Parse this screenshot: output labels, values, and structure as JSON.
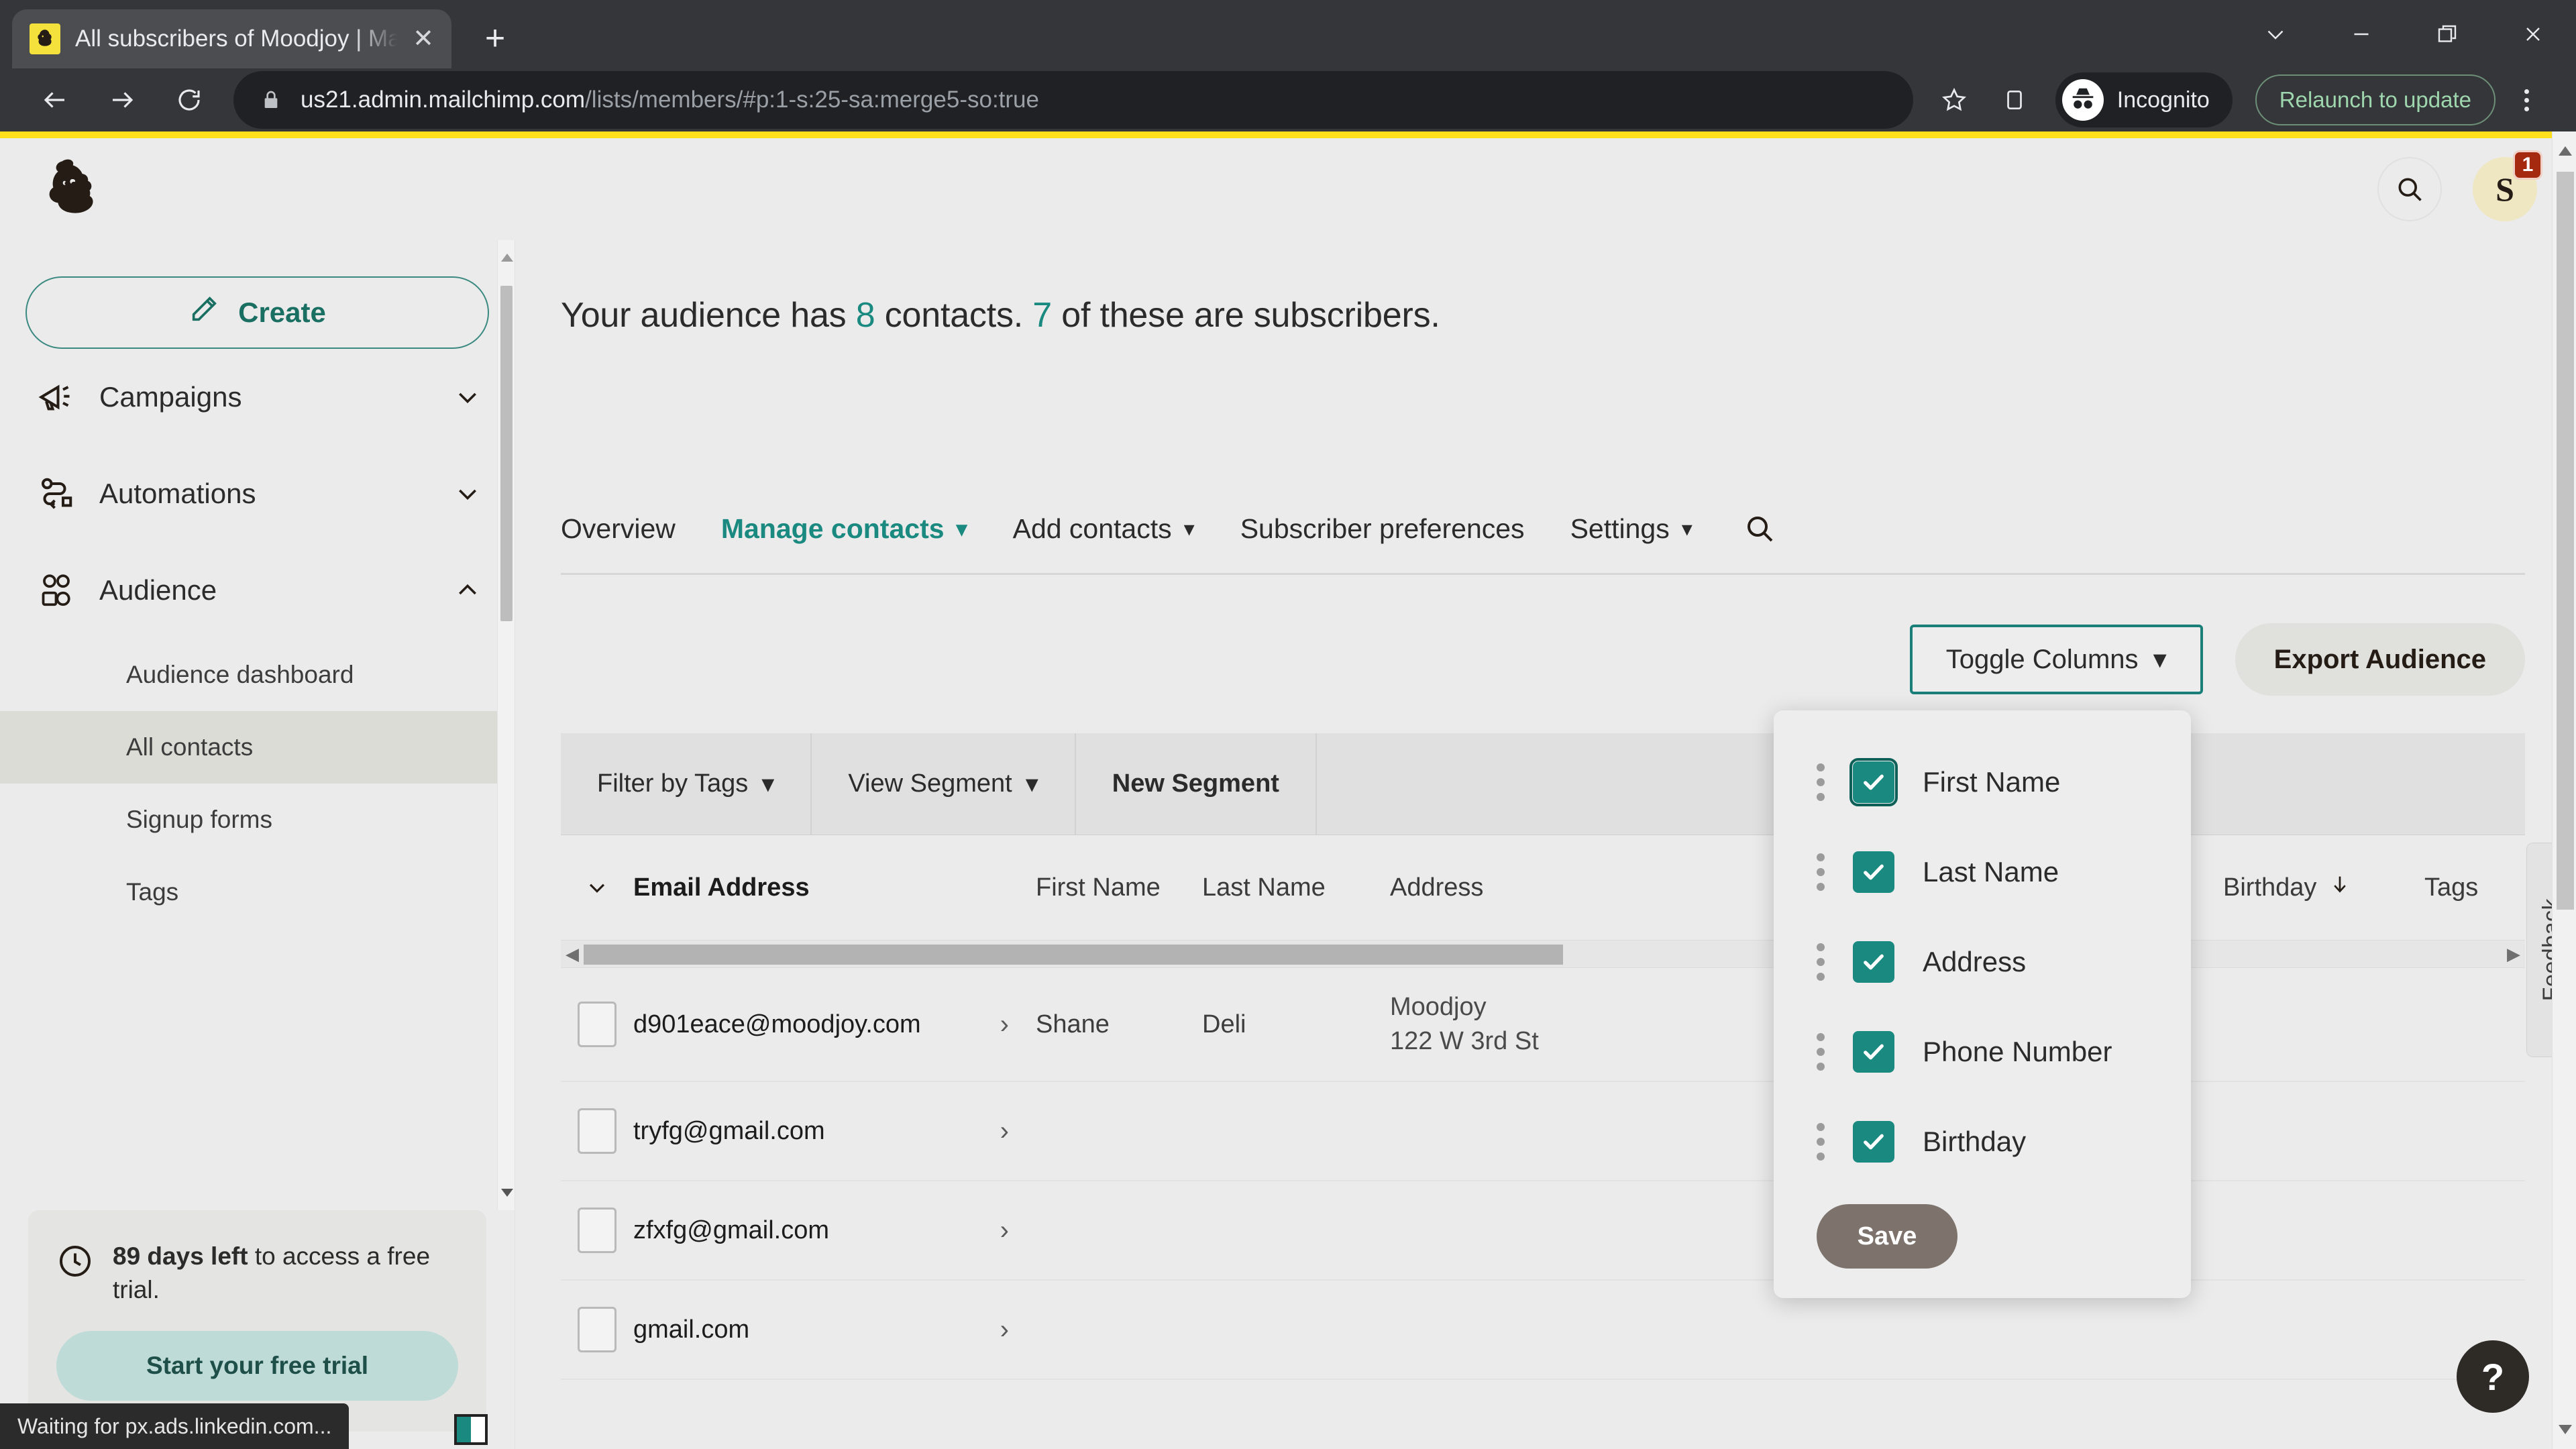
{
  "browser": {
    "tab": {
      "title": "All subscribers of Moodjoy | Mai",
      "favicon_icon": "mailchimp-favicon",
      "close_icon": "close-icon"
    },
    "new_tab_icon": "plus-icon",
    "window_controls": [
      {
        "name": "tab-search",
        "icon": "chevron-down-icon"
      },
      {
        "name": "minimize",
        "icon": "minimize-icon"
      },
      {
        "name": "maximize",
        "icon": "restore-icon"
      },
      {
        "name": "close",
        "icon": "close-icon"
      }
    ],
    "nav": {
      "back_icon": "arrow-left-icon",
      "forward_icon": "arrow-right-icon",
      "reload_icon": "reload-icon"
    },
    "omnibox": {
      "lock_icon": "lock-icon",
      "url_domain": "us21.admin.mailchimp.com",
      "url_path": "/lists/members/#p:1-s:25-sa:merge5-so:true"
    },
    "bookmark_icon": "star-icon",
    "side_panel_icon": "side-panel-icon",
    "incognito_label": "Incognito",
    "incognito_icon": "incognito-icon",
    "relaunch_label": "Relaunch to update",
    "menu_icon": "kebab-menu-icon",
    "status_text": "Waiting for px.ads.linkedin.com..."
  },
  "app": {
    "logo_icon": "mailchimp-logo",
    "search_icon": "search-icon",
    "avatar_initial": "S",
    "notification_count": "1"
  },
  "sidebar": {
    "create_label": "Create",
    "create_icon": "pencil-icon",
    "nav": [
      {
        "label": "Campaigns",
        "icon": "megaphone-icon",
        "chevron": "chevron-down-icon",
        "expanded": false
      },
      {
        "label": "Automations",
        "icon": "automation-icon",
        "chevron": "chevron-down-icon",
        "expanded": false
      },
      {
        "label": "Audience",
        "icon": "audience-icon",
        "chevron": "chevron-up-icon",
        "expanded": true
      }
    ],
    "sub_items": [
      {
        "label": "Audience dashboard",
        "active": false
      },
      {
        "label": "All contacts",
        "active": true
      },
      {
        "label": "Signup forms",
        "active": false
      },
      {
        "label": "Tags",
        "active": false
      }
    ],
    "trial": {
      "clock_icon": "clock-icon",
      "days": "89 days left",
      "rest": " to access a free trial.",
      "button_label": "Start your free trial"
    },
    "panel_toggle_icon": "panel-toggle-icon"
  },
  "main": {
    "audience_summary": {
      "prefix": "Your audience has ",
      "contacts_count": "8",
      "middle": " contacts. ",
      "subscribers_count": "7",
      "suffix": " of these are subscribers."
    },
    "tabs": [
      {
        "label": "Overview",
        "active": false,
        "caret": ""
      },
      {
        "label": "Manage contacts",
        "active": true,
        "caret": "chevron-down-icon"
      },
      {
        "label": "Add contacts",
        "active": false,
        "caret": "chevron-down-icon"
      },
      {
        "label": "Subscriber preferences",
        "active": false,
        "caret": ""
      },
      {
        "label": "Settings",
        "active": false,
        "caret": "chevron-down-icon"
      }
    ],
    "tab_search_icon": "search-icon",
    "toggle_columns_label": "Toggle Columns",
    "toggle_columns_caret": "chevron-down-icon",
    "export_label": "Export Audience",
    "cursor_icon": "pointer-cursor"
  },
  "dropdown": {
    "items": [
      {
        "label": "First Name",
        "checked": true,
        "focused": true,
        "grip": "drag-handle-icon",
        "check": "check-icon"
      },
      {
        "label": "Last Name",
        "checked": true,
        "focused": false,
        "grip": "drag-handle-icon",
        "check": "check-icon"
      },
      {
        "label": "Address",
        "checked": true,
        "focused": false,
        "grip": "drag-handle-icon",
        "check": "check-icon"
      },
      {
        "label": "Phone Number",
        "checked": true,
        "focused": false,
        "grip": "drag-handle-icon",
        "check": "check-icon"
      },
      {
        "label": "Birthday",
        "checked": true,
        "focused": false,
        "grip": "drag-handle-icon",
        "check": "check-icon"
      }
    ],
    "save_label": "Save"
  },
  "table": {
    "filters": [
      {
        "label": "Filter by Tags",
        "caret": "chevron-down-icon",
        "strong": false
      },
      {
        "label": "View Segment",
        "caret": "chevron-down-icon",
        "strong": false
      },
      {
        "label": "New Segment",
        "caret": "",
        "strong": true
      }
    ],
    "select_all_caret": "chevron-down-icon",
    "columns": {
      "email": "Email Address",
      "first": "First Name",
      "last": "Last Name",
      "address": "Address",
      "birthday": "Birthday",
      "birthday_sort_icon": "arrow-down-icon",
      "tags": "Tags"
    },
    "rows": [
      {
        "email": "d901eace@moodjoy.com",
        "chevron": "chevron-right-icon",
        "first": "Shane",
        "last": "Deli",
        "address_line1": "Moodjoy",
        "address_line2": "122 W 3rd St"
      },
      {
        "email": "tryfg@gmail.com",
        "chevron": "chevron-right-icon",
        "first": "",
        "last": "",
        "address_line1": "",
        "address_line2": ""
      },
      {
        "email": "zfxfg@gmail.com",
        "chevron": "chevron-right-icon",
        "first": "",
        "last": "",
        "address_line1": "",
        "address_line2": ""
      },
      {
        "email": "gmail.com",
        "chevron": "chevron-right-icon",
        "first": "",
        "last": "",
        "address_line1": "",
        "address_line2": ""
      }
    ],
    "hscroll_left_icon": "chevron-left-icon",
    "hscroll_right_icon": "chevron-right-icon"
  },
  "overlays": {
    "feedback_label": "Feedback",
    "help_label": "?"
  },
  "colors": {
    "accent_teal": "#1a8a80",
    "mailchimp_yellow": "#ffe01b",
    "badge_red": "#a5290f",
    "chrome_dark": "#35363a"
  }
}
